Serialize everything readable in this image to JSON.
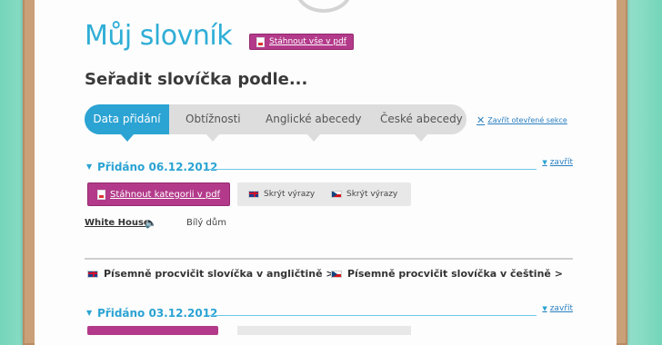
{
  "title": "Můj slovník",
  "download_all_pdf": "Stáhnout vše v pdf",
  "sort_heading": "Seřadit slovíčka podle...",
  "tabs": [
    {
      "label": "Data přidání",
      "active": true
    },
    {
      "label": "Obtížnosti",
      "active": false
    },
    {
      "label": "Anglické abecedy",
      "active": false
    },
    {
      "label": "České abecedy",
      "active": false
    }
  ],
  "close_open_sections": "Zavřít otevřené sekce",
  "sections": [
    {
      "label": "Přidáno 06.12.2012",
      "close": "zavřít",
      "download_category_pdf": "Stáhnout kategorii v pdf",
      "hide_en": "Skrýt výrazy",
      "hide_cs": "Skrýt výrazy",
      "words": [
        {
          "en": "White House",
          "cs": "Bílý dům"
        }
      ]
    },
    {
      "label": "Přidáno 03.12.2012",
      "close": "zavřít"
    }
  ],
  "practice": {
    "en": "Písemně procvičit slovíčka v angličtině >",
    "cs": "Písemně procvičit slovíčka v češtině >"
  },
  "colors": {
    "accent_blue": "#2ba3d3",
    "pdf_purple": "#b33a8a",
    "frame_wood": "#c9a078",
    "background_mint": "#a6e6d3"
  }
}
